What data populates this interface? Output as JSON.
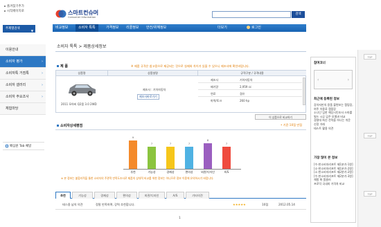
{
  "top_links": [
    "즐겨찾기추가",
    "시작페이지로"
  ],
  "logo": {
    "title": "스마트컨슈머",
    "subtitle": "Consumer Information"
  },
  "search": {
    "placeholder": "",
    "button_label": "검색"
  },
  "nav": {
    "items": [
      "비교정보",
      "소비자 톡톡",
      "가격정보",
      "리콜정보",
      "안전/위해정보"
    ],
    "active_index": 1,
    "more_label": "더보기",
    "login_label": "로그인"
  },
  "left_menu": {
    "button_label": "주제별검색",
    "items": [
      "이용안내",
      "소비자 평가",
      "소비자톡 거점톡",
      "소비자 갤러리",
      "소비자 주요조사",
      "체험마당"
    ],
    "active_index": 1,
    "bottom_label": "배심원 Tab 채널"
  },
  "breadcrumb": {
    "title": "소비자 톡톡 > 제품상세정보"
  },
  "product_section": {
    "heading": "제 품",
    "note": "※ 제품 규격은 참고용으로 제공되는 것으로 실제와 차이가 있을 수 있으니 제조사에 확인바랍니다.",
    "headers": [
      "상품명",
      "상품설명",
      "규격구분 / 규격내용"
    ],
    "name": "2011 모하비 Q2몸 3.0 2WD",
    "maker": "제조사 : 기아자동차",
    "detail_button": "제조사바로가기",
    "specs": [
      {
        "label": "제조사",
        "value": "기아자동차"
      },
      {
        "label": "배기량",
        "value": "2,959 cc"
      },
      {
        "label": "연료",
        "value": "경유"
      },
      {
        "label": "마력/토크",
        "value": "260 hp"
      }
    ],
    "compare_button": "이 상품으로 비교하기"
  },
  "chart_section": {
    "heading": "소비자상세평점",
    "note": "• 기준:10점 만점",
    "footnote": "※ 본 정보는 불합리적을 통한 소비자의 주관적 만족도조사로 제품의 상대적 비교를 위한 정보는 아니므로 정보 이용에 유의하시기 바랍니다."
  },
  "chart_data": {
    "type": "bar",
    "categories": [
      "추천",
      "기능성",
      "경제성",
      "편의성",
      "외관/디자인",
      "A/S"
    ],
    "values": [
      9,
      7,
      7,
      7,
      8,
      7
    ],
    "value_labels": [
      "9",
      "7",
      "7",
      "7",
      "8",
      "7"
    ],
    "colors": [
      "#f48a2a",
      "#8bc43f",
      "#f6c61a",
      "#4fb2e3",
      "#9b5fc0",
      "#ef4b3e"
    ],
    "ylim": [
      0,
      10
    ],
    "grid": false
  },
  "review_tabs": {
    "items": [
      "추천",
      "기능성",
      "경제성",
      "편의성",
      "외관/디자인",
      "A/S",
      "기타의견"
    ],
    "active_index": 0
  },
  "review": {
    "title": "테스용 남의 의견",
    "text": "정말 만족하며, 강력 추천합니다.",
    "stars": "★★★★★",
    "score": "10점",
    "date": "2012.05.14"
  },
  "pager": {
    "current": "1"
  },
  "right_sidebar": {
    "banner_head": "참여코너",
    "top_label": "TOP",
    "hot_head": "최근에 등록된 정보",
    "hot_items": [
      "강아지만의 용품 불편보는 캠핑장,",
      "여주 이용료 캠핑장",
      "소나단 입한 해당시민조사 스마를",
      "빌드 시공 입주 모델과 비교",
      "경찰대 최신 전적을 하나는 쉬운",
      "신정 거래",
      "테스트 활용 의견"
    ],
    "compare_head": "가장 많이 본 정보",
    "compare_items": [
      "[수-한소비자리포트 제1분기-1원]",
      "[소-한소비자리포트 제1분기-2원]",
      "[소-한소비자리포트 제2분기-2원]",
      "[수-한소비자리포트 제2분기-3원]",
      "체험 화 폼클러",
      "프로덕 국내외 가격차 비교"
    ]
  }
}
